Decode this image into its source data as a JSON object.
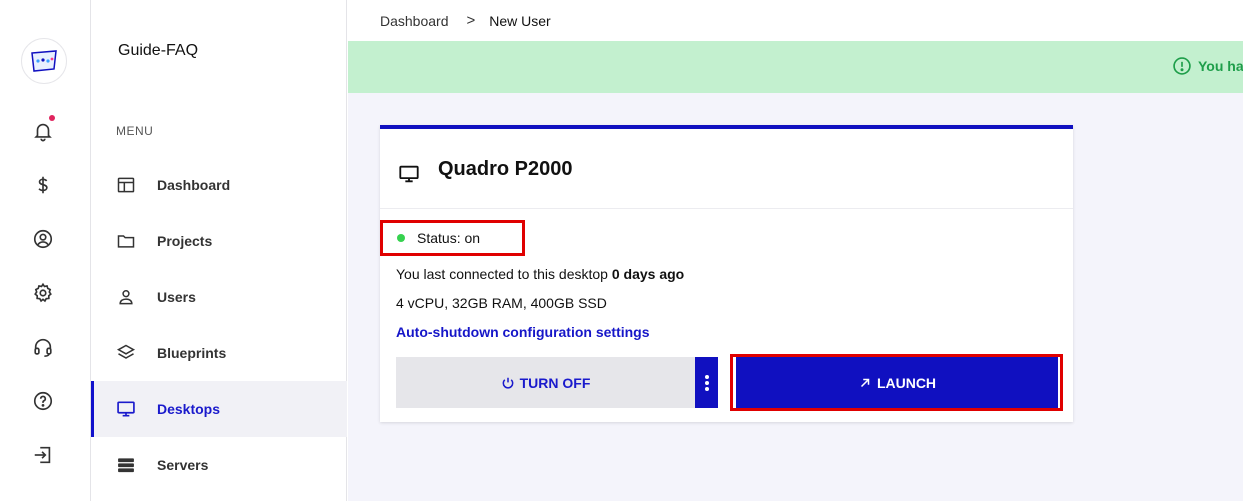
{
  "app": {
    "org_name": "Guide-FAQ"
  },
  "rail": {
    "items": [
      "logo",
      "bell-icon",
      "dollar-icon",
      "user-circle-icon",
      "gear-icon",
      "headset-icon",
      "help-icon",
      "logout-icon"
    ],
    "has_notification": true
  },
  "sidebar": {
    "menu_label": "MENU",
    "items": [
      {
        "label": "Dashboard",
        "icon": "dashboard-icon",
        "active": false
      },
      {
        "label": "Projects",
        "icon": "folder-icon",
        "active": false
      },
      {
        "label": "Users",
        "icon": "user-icon",
        "active": false
      },
      {
        "label": "Blueprints",
        "icon": "layers-icon",
        "active": false
      },
      {
        "label": "Desktops",
        "icon": "monitor-icon",
        "active": true
      },
      {
        "label": "Servers",
        "icon": "server-icon",
        "active": false
      }
    ]
  },
  "breadcrumb": {
    "parent": "Dashboard",
    "separator": ">",
    "current": "New User"
  },
  "banner": {
    "text": "You ha"
  },
  "desktop_card": {
    "title": "Quadro P2000",
    "status": "Status: on",
    "last_connected_prefix": "You last connected to this desktop",
    "last_connected_value": "0 days ago",
    "specs": "4 vCPU, 32GB RAM, 400GB SSD",
    "auto_shutdown_link": "Auto-shutdown configuration settings",
    "turn_off_label": "TURN OFF",
    "launch_label": "LAUNCH"
  },
  "colors": {
    "accent": "#1010c0",
    "status_on": "#36d24f",
    "banner_bg": "#c3f0cf",
    "banner_text": "#1e9e4a",
    "highlight": "#e00000"
  }
}
